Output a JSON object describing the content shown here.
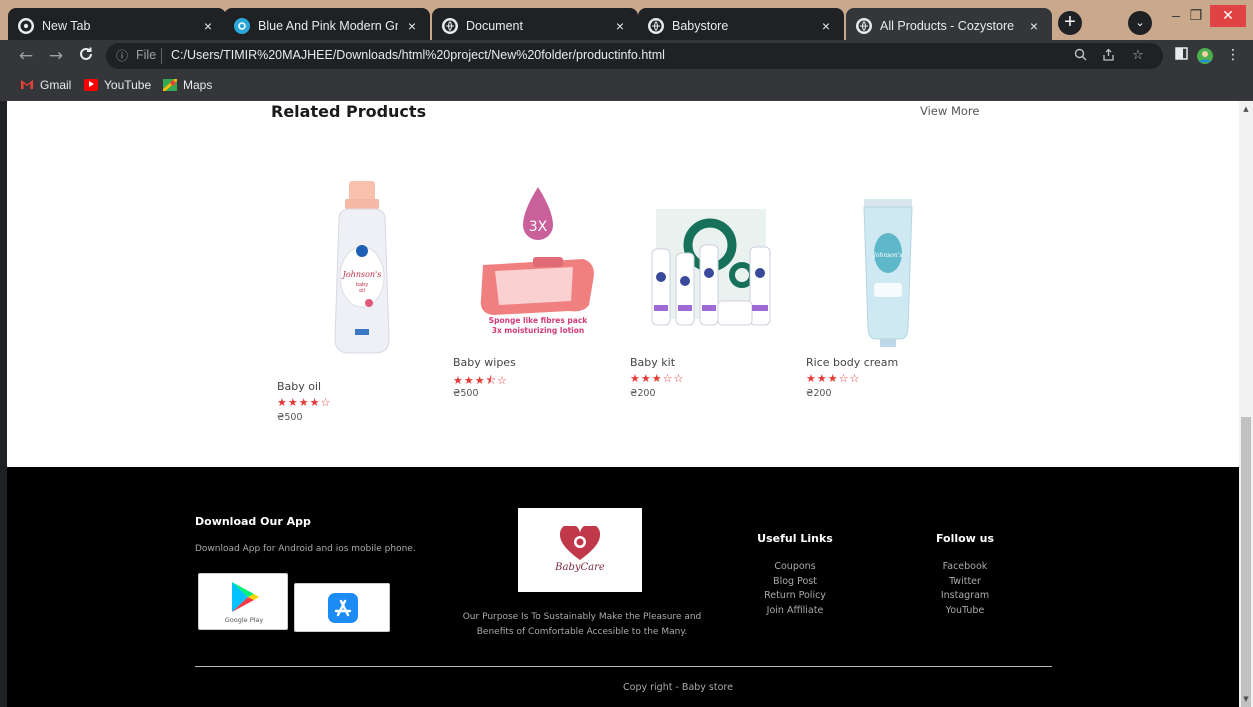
{
  "browser": {
    "tabs": [
      {
        "title": "New Tab",
        "icon": "chrome-icon",
        "active": false
      },
      {
        "title": "Blue And Pink Modern Graphic",
        "icon": "canva-icon",
        "active": false
      },
      {
        "title": "Document",
        "icon": "globe-icon",
        "active": false
      },
      {
        "title": "Babystore",
        "icon": "globe-icon",
        "active": false
      },
      {
        "title": "All Products - Cozystore",
        "icon": "globe-icon",
        "active": true
      }
    ],
    "close_glyph": "×",
    "new_tab_glyph": "+",
    "tab_search_glyph": "⌄",
    "window_controls": {
      "minimize": "–",
      "restore": "❐",
      "close": "✕"
    },
    "nav": {
      "back": "←",
      "forward": "→",
      "reload": "C"
    },
    "omnibox": {
      "info_glyph": "ⓘ",
      "scheme_label": "File",
      "url": "C:/Users/TIMIR%20MAJHEE/Downloads/html%20project/New%20folder/productinfo.html"
    },
    "bookmarks": [
      {
        "label": "Gmail",
        "icon": "gmail-icon"
      },
      {
        "label": "YouTube",
        "icon": "youtube-icon"
      },
      {
        "label": "Maps",
        "icon": "maps-icon"
      }
    ]
  },
  "page": {
    "related_title": "Related Products",
    "view_more": "View More",
    "products": [
      {
        "name": "Baby oil",
        "rating": 4,
        "stars": "★★★★☆",
        "price": "₴500"
      },
      {
        "name": "Baby wipes",
        "rating": 3.5,
        "stars": "★★★⯪☆",
        "price": "₴500",
        "image_caption_1": "Sponge like fibres pack",
        "image_caption_2": "3x moisturizing lotion",
        "image_badge": "3X"
      },
      {
        "name": "Baby kit",
        "rating": 3,
        "stars": "★★★☆☆",
        "price": "₴200"
      },
      {
        "name": "Rice body cream",
        "rating": 3,
        "stars": "★★★☆☆",
        "price": "₴200"
      }
    ],
    "footer": {
      "download": {
        "title": "Download Our App",
        "text": "Download App for Android and ios mobile phone.",
        "google_play_label": "Google Play"
      },
      "brand": {
        "logo_text": "BabyCare",
        "purpose_line1": "Our Purpose Is To Sustainably Make the Pleasure and",
        "purpose_line2": "Benefits of Comfortable Accesible to the Many."
      },
      "useful_links": {
        "title": "Useful Links",
        "items": [
          "Coupons",
          "Blog Post",
          "Return Policy",
          "Join Affiliate"
        ]
      },
      "follow": {
        "title": "Follow us",
        "items": [
          "Facebook",
          "Twitter",
          "Instagram",
          "YouTube"
        ]
      },
      "copyright": "Copy right - Baby store"
    }
  },
  "colors": {
    "accent_star": "#e53935",
    "footer_bg": "#000000",
    "brand": "#c0394b"
  }
}
